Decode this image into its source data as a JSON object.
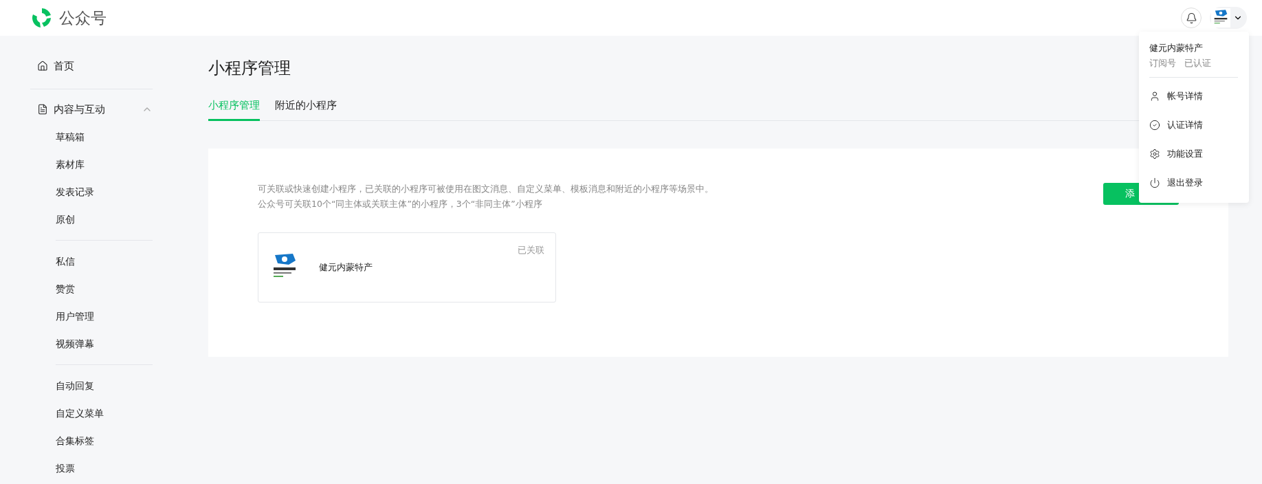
{
  "header": {
    "brand": "公众号"
  },
  "sidebar": {
    "items": [
      {
        "kind": "link",
        "label": "首页"
      },
      {
        "kind": "group",
        "label": "内容与互动",
        "expanded": true,
        "groups": [
          [
            "草稿箱",
            "素材库",
            "发表记录",
            "原创"
          ],
          [
            "私信",
            "赞赏",
            "用户管理",
            "视频弹幕"
          ],
          [
            "自动回复",
            "自定义菜单",
            "合集标签",
            "投票"
          ]
        ]
      }
    ]
  },
  "page": {
    "title": "小程序管理",
    "tabs": [
      {
        "label": "小程序管理",
        "selected": true
      },
      {
        "label": "附近的小程序",
        "selected": false
      }
    ],
    "description": [
      "可关联或快速创建小程序，已关联的小程序可被使用在图文消息、自定义菜单、模板消息和附近的小程序等场景中。",
      "公众号可关联10个“同主体或关联主体”的小程序，3个“非同主体”小程序"
    ],
    "add_button": "添",
    "programs": [
      {
        "name": "健元内蒙特产",
        "status": "已关联"
      }
    ]
  },
  "account_menu": {
    "name": "健元内蒙特产",
    "type": "订阅号",
    "verified": "已认证",
    "items": [
      {
        "label": "帐号详情"
      },
      {
        "label": "认证详情"
      },
      {
        "label": "功能设置"
      },
      {
        "label": "退出登录"
      }
    ]
  }
}
